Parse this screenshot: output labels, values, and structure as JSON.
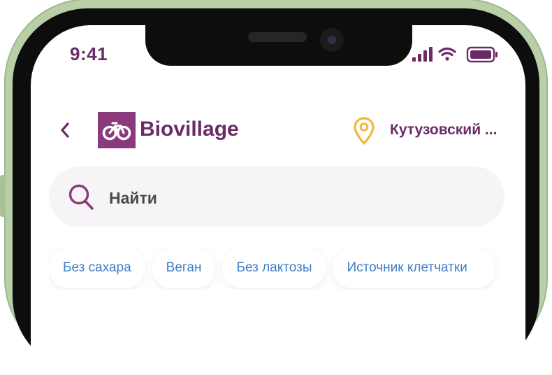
{
  "status_bar": {
    "time": "9:41",
    "icons": [
      "signal-icon",
      "wifi-icon",
      "battery-icon"
    ]
  },
  "header": {
    "back_icon": "chevron-left-icon",
    "brand": "Biovillage",
    "location_icon": "map-pin-icon",
    "location": "Кутузовский ..."
  },
  "search": {
    "icon": "search-icon",
    "placeholder": "Найти"
  },
  "filters": [
    {
      "label": "Без сахара"
    },
    {
      "label": "Веган"
    },
    {
      "label": "Без лактозы"
    },
    {
      "label": "Источник клетчатки"
    }
  ],
  "colors": {
    "brand": "#8a3a7c",
    "brand_text": "#6a2b66",
    "location_pin": "#f2b63c",
    "chip_text": "#3f7fc7",
    "search_bg": "#f6f4f6",
    "phone_frame": "#b9cfa8"
  }
}
